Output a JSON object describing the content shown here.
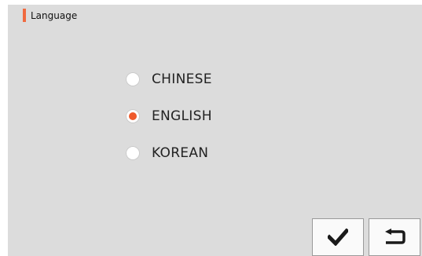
{
  "header": {
    "title": "Language",
    "accent_color": "#f06a40"
  },
  "options": [
    {
      "label": "CHINESE",
      "selected": false
    },
    {
      "label": "ENGLISH",
      "selected": true
    },
    {
      "label": "KOREAN",
      "selected": false
    }
  ],
  "radio_selected_color": "#ef5a2c",
  "buttons": {
    "confirm_icon": "check-icon",
    "back_icon": "return-icon"
  }
}
